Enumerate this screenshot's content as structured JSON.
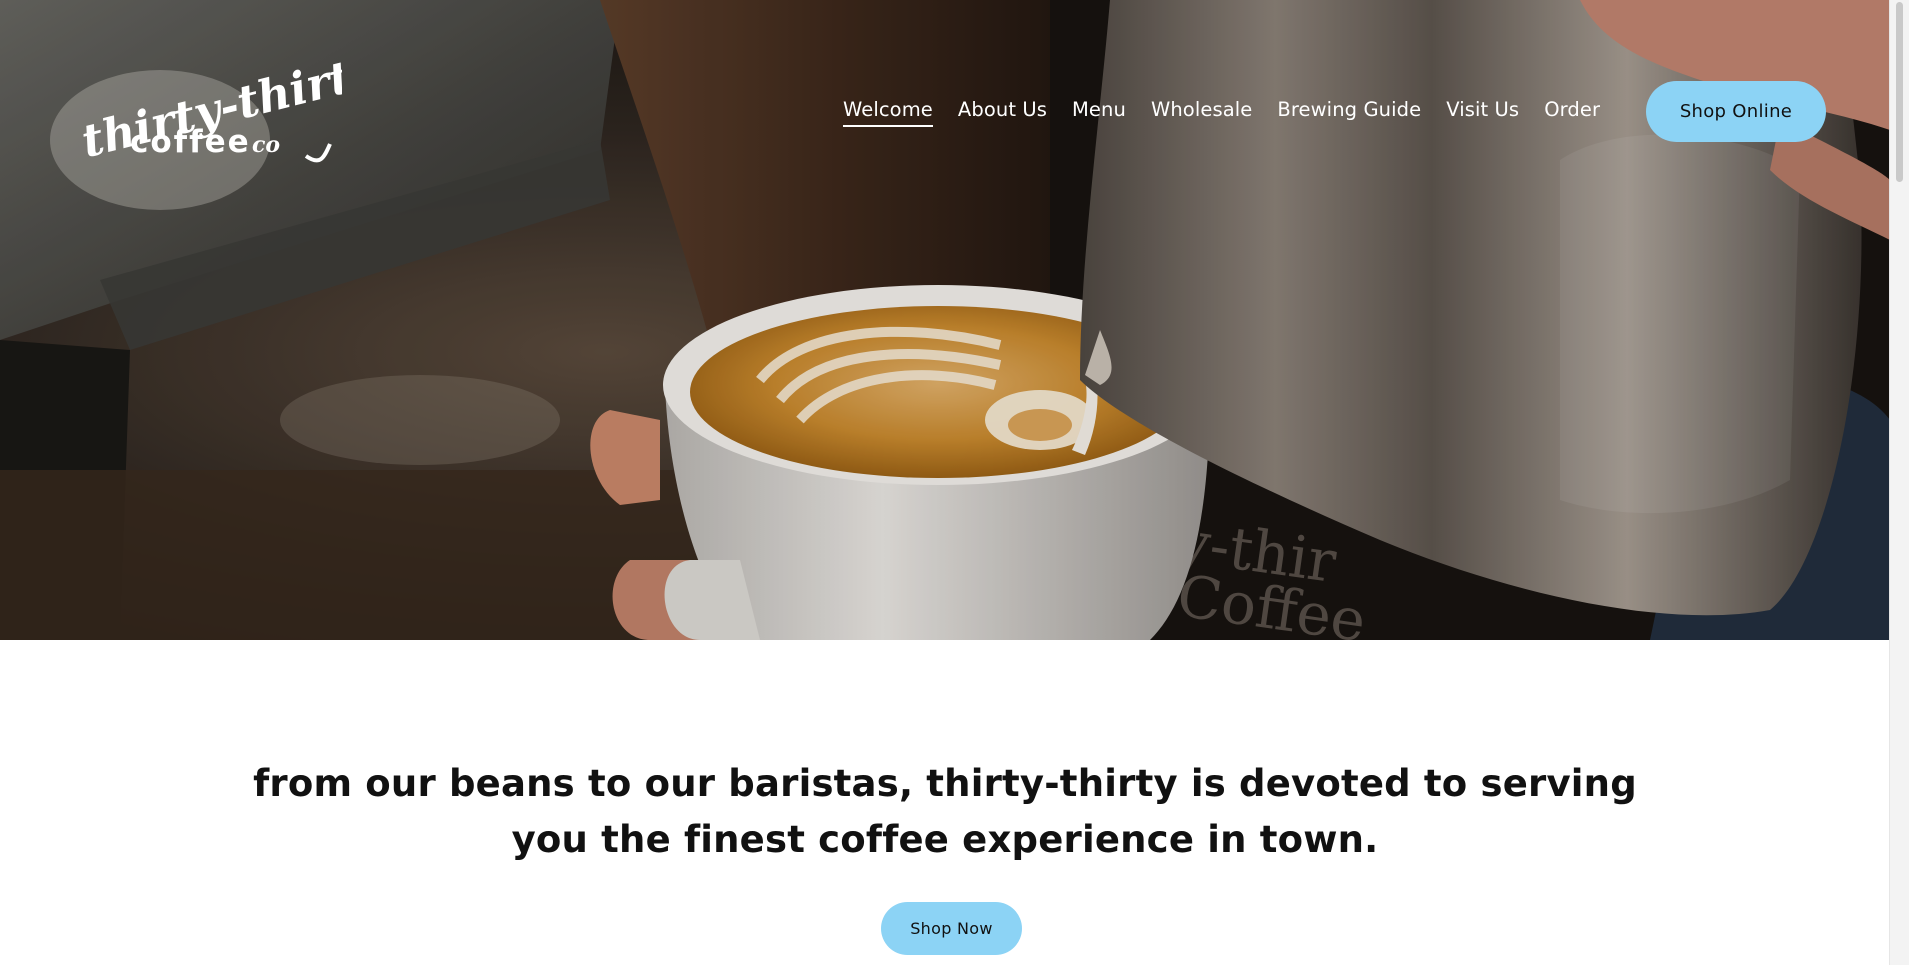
{
  "brand": {
    "logo_line1": "thirty-thirty",
    "logo_line2": "coffee",
    "logo_suffix": "co"
  },
  "nav": {
    "items": [
      {
        "label": "Welcome",
        "active": true
      },
      {
        "label": "About Us",
        "active": false
      },
      {
        "label": "Menu",
        "active": false
      },
      {
        "label": "Wholesale",
        "active": false
      },
      {
        "label": "Brewing Guide",
        "active": false
      },
      {
        "label": "Visit Us",
        "active": false
      },
      {
        "label": "Order",
        "active": false
      }
    ],
    "cta_label": "Shop Online"
  },
  "intro": {
    "tagline_line1": "from our beans to our baristas, thirty-thirty is devoted to serving",
    "tagline_line2": "you the finest coffee experience in town.",
    "button_label": "Shop Now"
  },
  "colors": {
    "accent": "#8cd3f5",
    "text_dark": "#111111",
    "nav_text": "#ffffff"
  }
}
